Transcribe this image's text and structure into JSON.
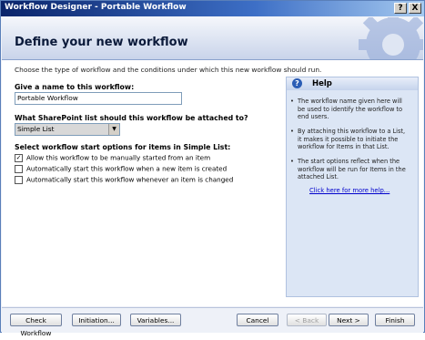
{
  "window": {
    "title": "Workflow Designer - Portable Workflow",
    "help_button": "?",
    "close_button": "X"
  },
  "header": {
    "title": "Define your new workflow"
  },
  "main": {
    "intro": "Choose the type of workflow and the conditions under which this new workflow should run.",
    "name_label": "Give a name to this workflow:",
    "name_value": "Portable Workflow",
    "list_label": "What SharePoint list should this workflow be attached to?",
    "list_selected": "Simple List",
    "start_label": "Select workflow start options for items in Simple List:",
    "options": [
      {
        "label": "Allow this workflow to be manually started from an item",
        "checked": true
      },
      {
        "label": "Automatically start this workflow when a new item is created",
        "checked": false
      },
      {
        "label": "Automatically start this workflow whenever an item is changed",
        "checked": false
      }
    ]
  },
  "help": {
    "icon": "help-question-icon",
    "title": "Help",
    "bullets": [
      "The workflow name given here will be used to identify the workflow to end users.",
      "By attaching this workflow to a List, it makes it possible to initiate the workflow for Items in that List.",
      "The start options reflect when the workflow will be run for Items in the attached List."
    ],
    "link": "Click here for more help..."
  },
  "footer": {
    "check_workflow": "Check Workflow",
    "initiation": "Initiation...",
    "variables": "Variables...",
    "cancel": "Cancel",
    "back": "< Back",
    "next": "Next >",
    "finish": "Finish"
  }
}
